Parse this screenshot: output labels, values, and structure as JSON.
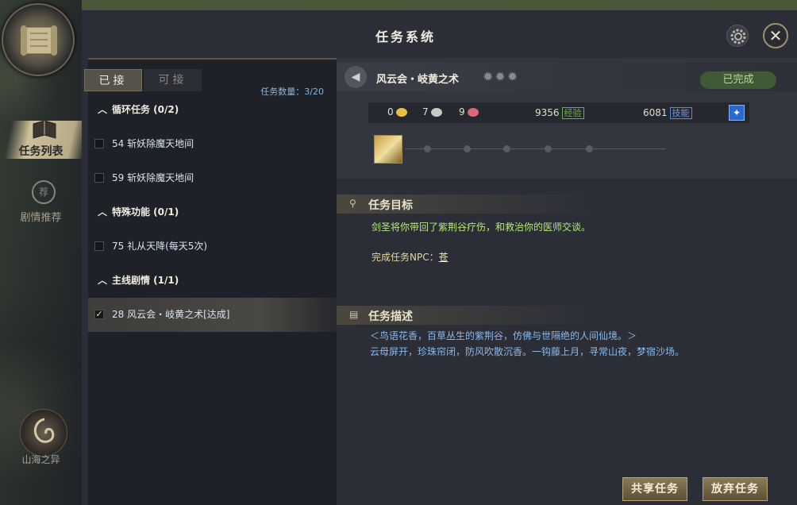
{
  "window": {
    "title": "任务系统"
  },
  "sidebar": {
    "items": [
      {
        "label": "任务列表"
      },
      {
        "label": "剧情推荐",
        "badge": "荐"
      }
    ],
    "bottom_label": "山海之异"
  },
  "tabs": [
    {
      "label": "已接"
    },
    {
      "label": "可接"
    }
  ],
  "quest_count": "任务数量：3/20",
  "quest_list": [
    {
      "type": "group",
      "label": "循环任务 (0/2)"
    },
    {
      "type": "quest",
      "label": "54 斩妖除魔天地间",
      "checked": false
    },
    {
      "type": "quest",
      "label": "59 斩妖除魔天地间",
      "checked": false
    },
    {
      "type": "group",
      "label": "特殊功能 (0/1)"
    },
    {
      "type": "quest",
      "label": "75 礼从天降(每天5次)",
      "checked": false
    },
    {
      "type": "group",
      "label": "主线剧情 (1/1)"
    },
    {
      "type": "quest",
      "label": "28 风云会・岐黄之术[达成]",
      "checked": true,
      "selected": true
    }
  ],
  "detail": {
    "quest_name": "风云会・岐黄之术",
    "status": "已完成",
    "rewards": {
      "gold": "0",
      "silver": "7",
      "copper": "9",
      "exp": "9356",
      "exp_tag": "经验",
      "skill": "6081",
      "skill_tag": "技能"
    },
    "objective_title": "任务目标",
    "objective_text": "剑圣将你带回了紫荆谷疗伤，和救治你的医师交谈。",
    "npc_label": "完成任务NPC：",
    "npc_name": "苍",
    "description_title": "任务描述",
    "description_line1": "＜鸟语花香，百草丛生的紫荆谷，仿佛与世隔绝的人间仙境。＞",
    "description_line2": "云母屏开，珍珠帘闭，防风吹散沉香。一钩藤上月，寻常山夜，梦宿沙场。"
  },
  "buttons": {
    "share": "共享任务",
    "abandon": "放弃任务"
  },
  "colors": {
    "completed": "#3f5a36",
    "objective": "#b8e878",
    "description": "#8ab8e8"
  }
}
